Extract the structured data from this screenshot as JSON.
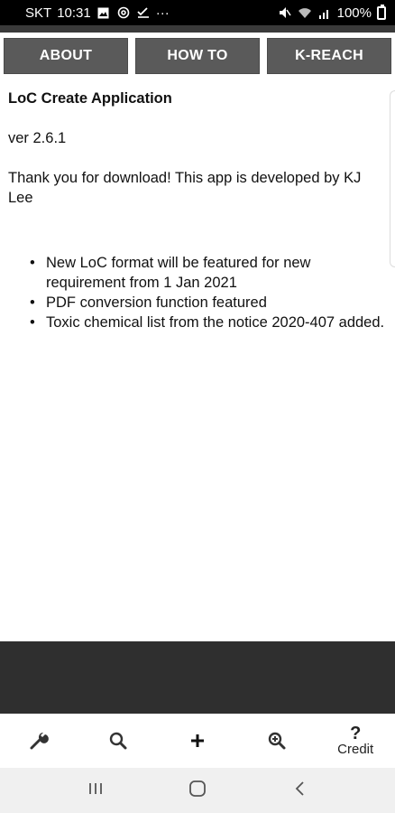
{
  "status_bar": {
    "carrier": "SKT",
    "time": "10:31",
    "more": "···",
    "battery_text": "100%",
    "icons": [
      "gallery-icon",
      "at-icon",
      "check-icon",
      "mute-icon",
      "wifi-icon",
      "signal-icon",
      "battery-icon"
    ]
  },
  "tabs": [
    {
      "label": "ABOUT"
    },
    {
      "label": "HOW TO"
    },
    {
      "label": "K-REACH"
    }
  ],
  "content": {
    "title": "LoC Create Application",
    "version": "ver 2.6.1",
    "thanks": "Thank you for download! This app is developed by KJ Lee",
    "features": [
      "New LoC format will be featured for new requirement from 1 Jan 2021",
      "PDF conversion function featured",
      "Toxic chemical list from the notice 2020-407 added."
    ]
  },
  "toolbar": {
    "tools": [
      "wrench-icon",
      "search-icon",
      "plus-icon",
      "zoom-in-icon"
    ],
    "credit_symbol": "?",
    "credit_label": "Credit"
  },
  "nav_bar": {
    "buttons": [
      "recent-apps-icon",
      "home-icon",
      "back-icon"
    ]
  },
  "colors": {
    "status_bar": "#000000",
    "tab_button": "#5a5a5a",
    "dark_band": "#2f2f2f",
    "nav_bar": "#f0f0f0"
  }
}
